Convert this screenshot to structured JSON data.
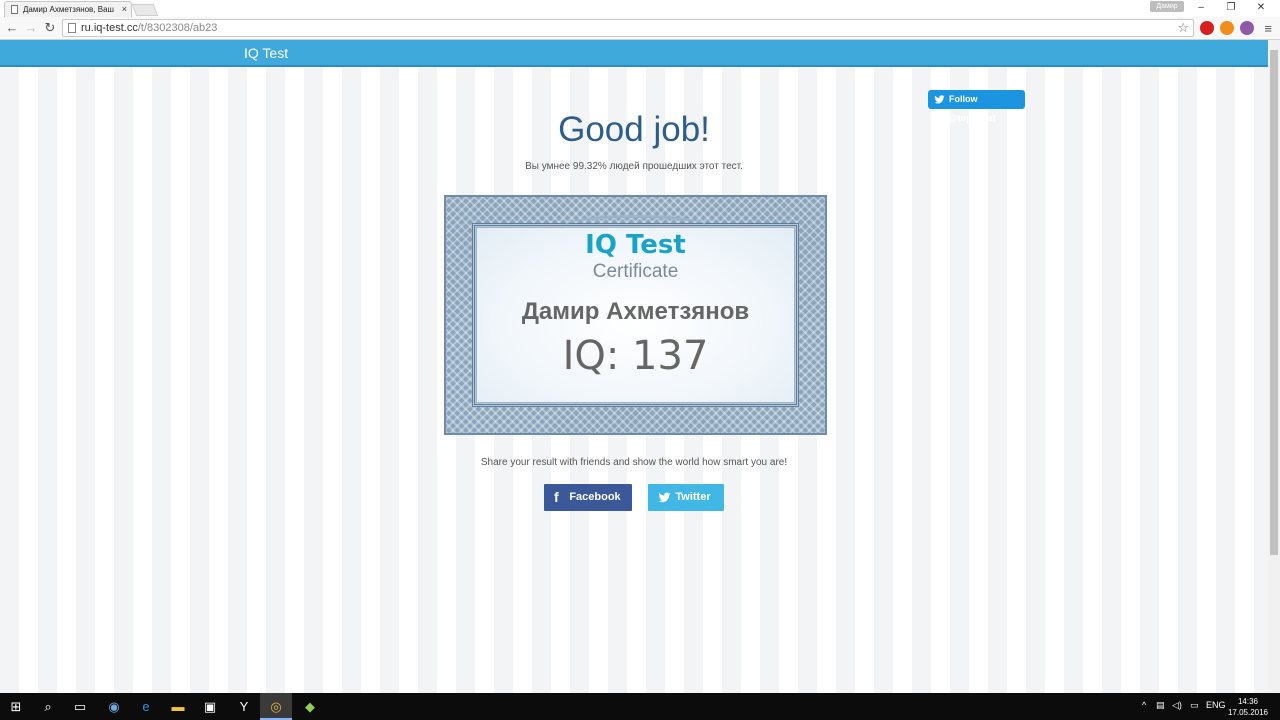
{
  "browser": {
    "tab_title": "Дамир Ахметзянов, Ваш",
    "tab_close": "×",
    "profile_badge": "Дамир",
    "url_host": "ru.iq-test.cc",
    "url_path": "/t/8302308/ab23"
  },
  "site": {
    "brand": "IQ Test",
    "follow_button": "Follow @topiqtest",
    "headline": "Good job!",
    "subline": "Вы умнее 99.32% людей прошедших этот тест.",
    "share_text": "Share your result with friends and show the world how smart you are!",
    "facebook_label": "Facebook",
    "twitter_label": "Twitter"
  },
  "certificate": {
    "title": "IQ Test",
    "subtitle": "Certificate",
    "name": "Дамир Ахметзянов",
    "iq_text": "IQ: 137"
  },
  "taskbar": {
    "language": "ENG",
    "time": "14:36",
    "date": "17.05.2016"
  },
  "colors": {
    "nav_bar": "#3fa9db",
    "headline": "#2d5d8a",
    "facebook": "#3b5998",
    "twitter": "#41b7e6",
    "follow": "#1b95e0",
    "cert_title": "#1aa3c9"
  }
}
